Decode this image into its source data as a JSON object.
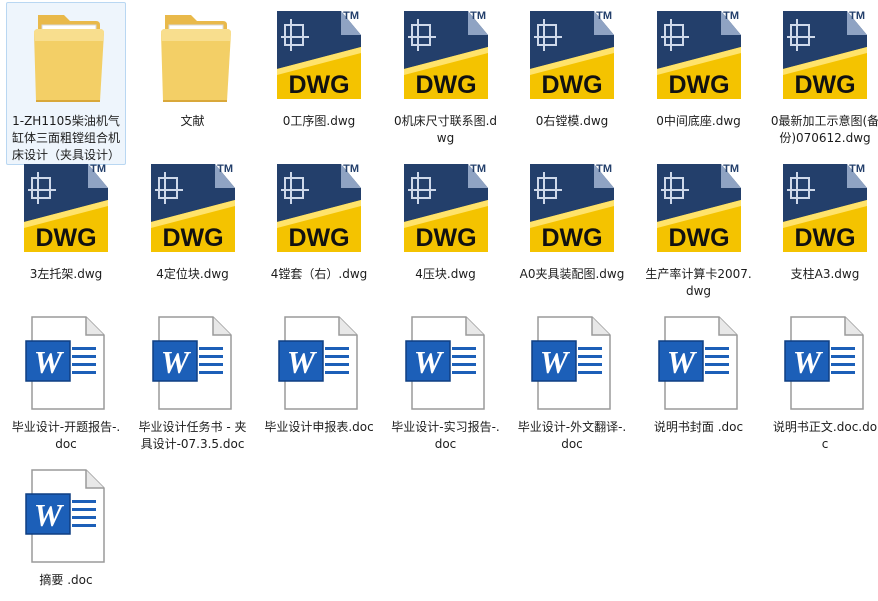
{
  "files": [
    {
      "name": "1-ZH1105柴油机气缸体三面粗镗组合机床设计（夹具设计）",
      "type": "folder",
      "selected": true
    },
    {
      "name": "文献",
      "type": "folder"
    },
    {
      "name": "0工序图.dwg",
      "type": "dwg"
    },
    {
      "name": "0机床尺寸联系图.dwg",
      "type": "dwg"
    },
    {
      "name": "0右镗模.dwg",
      "type": "dwg"
    },
    {
      "name": "0中间底座.dwg",
      "type": "dwg"
    },
    {
      "name": "0最新加工示意图(备份)070612.dwg",
      "type": "dwg"
    },
    {
      "name": "3左托架.dwg",
      "type": "dwg"
    },
    {
      "name": "4定位块.dwg",
      "type": "dwg"
    },
    {
      "name": "4镗套（右）.dwg",
      "type": "dwg"
    },
    {
      "name": "4压块.dwg",
      "type": "dwg"
    },
    {
      "name": "A0夹具装配图.dwg",
      "type": "dwg"
    },
    {
      "name": "生产率计算卡2007.dwg",
      "type": "dwg"
    },
    {
      "name": "支柱A3.dwg",
      "type": "dwg"
    },
    {
      "name": "毕业设计-开题报告-.doc",
      "type": "doc"
    },
    {
      "name": "毕业设计任务书 - 夹具设计-07.3.5.doc",
      "type": "doc"
    },
    {
      "name": "毕业设计申报表.doc",
      "type": "doc"
    },
    {
      "name": "毕业设计-实习报告-.doc",
      "type": "doc"
    },
    {
      "name": "毕业设计-外文翻译-.doc",
      "type": "doc"
    },
    {
      "name": "说明书封面 .doc",
      "type": "doc"
    },
    {
      "name": "说明书正文.doc.doc",
      "type": "doc"
    },
    {
      "name": "摘要 .doc",
      "type": "doc"
    }
  ],
  "icon_text": {
    "dwg": "DWG",
    "tm": "TM",
    "word": "W"
  },
  "colors": {
    "folder": "#f3cf66",
    "dwg_yellow": "#f4c300",
    "dwg_navy": "#233f6b",
    "word_blue": "#1c5fb8",
    "selection": "#eef5fc"
  }
}
